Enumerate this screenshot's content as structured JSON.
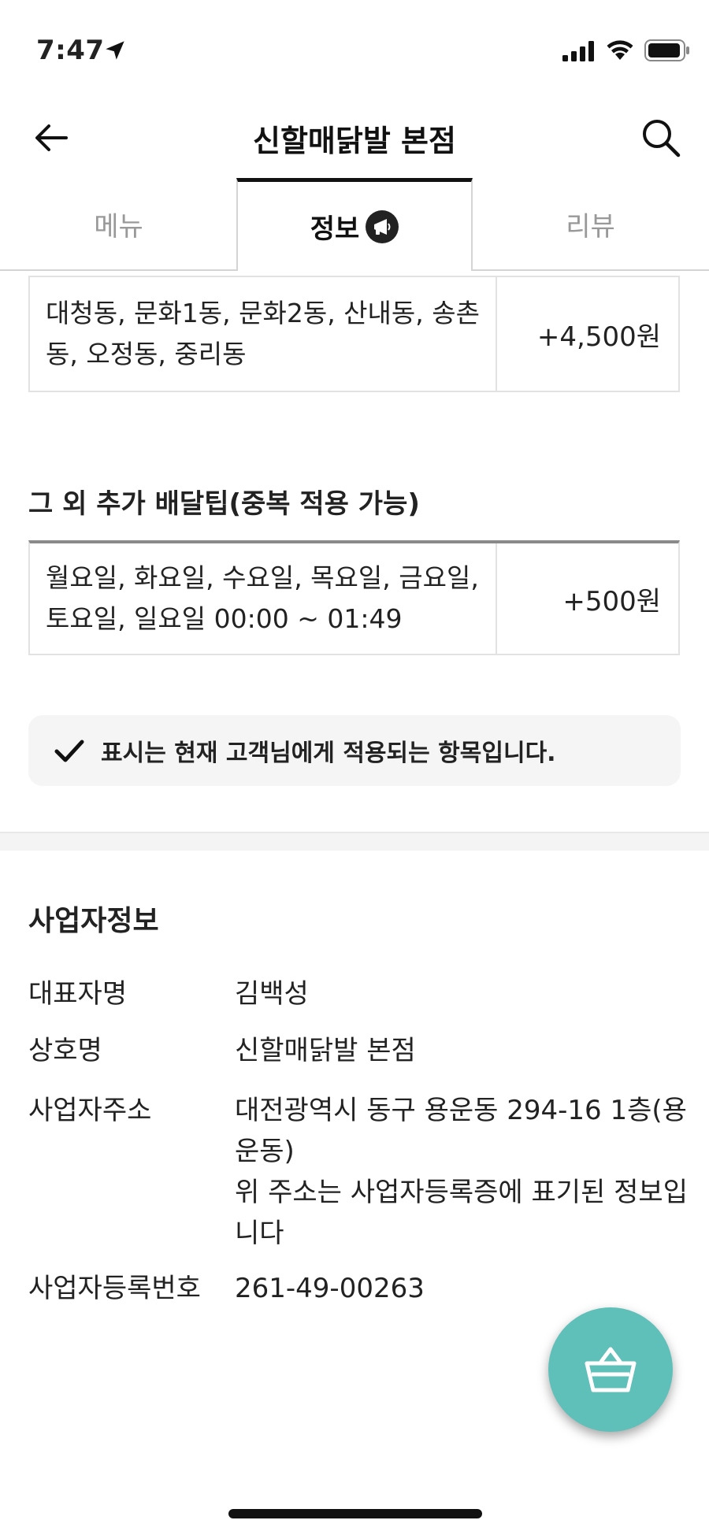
{
  "status_bar": {
    "time": "7:47"
  },
  "header": {
    "title": "신할매닭발 본점"
  },
  "tabs": [
    {
      "label": "메뉴"
    },
    {
      "label": "정보"
    },
    {
      "label": "리뷰"
    }
  ],
  "delivery_area": {
    "areas": "대청동, 문화1동, 문화2동, 산내동, 송촌동, 오정동, 중리동",
    "fee": "+4,500원"
  },
  "extra_tip": {
    "title": "그 외 추가 배달팁(중복 적용 가능)",
    "condition": "월요일, 화요일, 수요일, 목요일, 금요일, 토요일, 일요일 00:00 ~ 01:49",
    "fee": "+500원"
  },
  "notice": {
    "text": "표시는 현재 고객님에게 적용되는 항목입니다."
  },
  "business_info": {
    "title": "사업자정보",
    "rows": [
      {
        "label": "대표자명",
        "value": "김백성"
      },
      {
        "label": "상호명",
        "value": "신할매닭발 본점"
      },
      {
        "label": "사업자주소",
        "value": "대전광역시 동구 용운동 294-16 1층(용운동)",
        "note": "위 주소는 사업자등록증에 표기된 정보입니다"
      },
      {
        "label": "사업자등록번호",
        "value": "261-49-00263"
      }
    ]
  },
  "colors": {
    "accent": "#5fbfb9",
    "text": "#222222",
    "muted": "#999999"
  },
  "icons": [
    "location-arrow-icon",
    "signal-icon",
    "wifi-icon",
    "battery-icon",
    "back-arrow-icon",
    "search-icon",
    "megaphone-badge-icon",
    "check-icon",
    "cart-basket-icon"
  ]
}
